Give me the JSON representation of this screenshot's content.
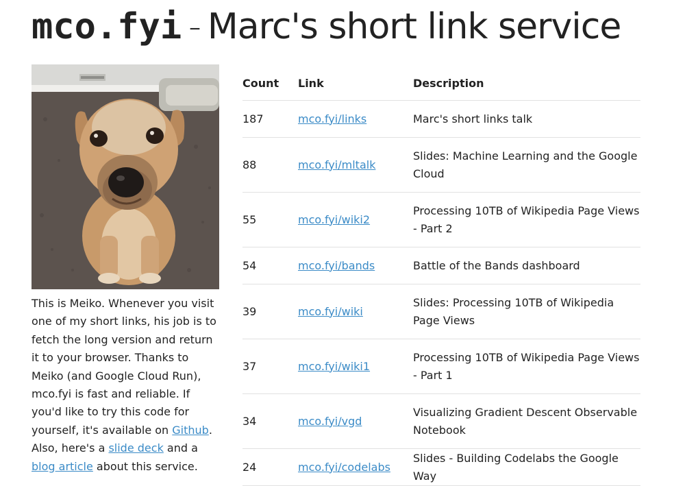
{
  "header": {
    "brand": "mco.fyi",
    "separator": "-",
    "subtitle": "Marc's short link service"
  },
  "sidebar": {
    "bio_part1": "This is Meiko. Whenever you visit one of my short links, his job is to fetch the long version and return it to your browser. Thanks to Meiko (and Google Cloud Run), mco.fyi is fast and reliable. If you'd like to try this code for yourself, it's available on ",
    "github_link": "Github",
    "bio_part2": ". Also, here's a ",
    "slides_link": "slide deck",
    "bio_part3": " and a ",
    "blog_link": "blog article",
    "bio_part4": " about this service."
  },
  "table": {
    "headers": {
      "count": "Count",
      "link": "Link",
      "description": "Description"
    },
    "rows": [
      {
        "count": "187",
        "link": "mco.fyi/links",
        "description": "Marc's short links talk"
      },
      {
        "count": "88",
        "link": "mco.fyi/mltalk",
        "description": "Slides: Machine Learning and the Google Cloud"
      },
      {
        "count": "55",
        "link": "mco.fyi/wiki2",
        "description": "Processing 10TB of Wikipedia Page Views - Part 2"
      },
      {
        "count": "54",
        "link": "mco.fyi/bands",
        "description": "Battle of the Bands dashboard"
      },
      {
        "count": "39",
        "link": "mco.fyi/wiki",
        "description": "Slides: Processing 10TB of Wikipedia Page Views"
      },
      {
        "count": "37",
        "link": "mco.fyi/wiki1",
        "description": "Processing 10TB of Wikipedia Page Views - Part 1"
      },
      {
        "count": "34",
        "link": "mco.fyi/vgd",
        "description": "Visualizing Gradient Descent Observable Notebook"
      },
      {
        "count": "24",
        "link": "mco.fyi/codelabs",
        "description": "Slides - Building Codelabs the Google Way"
      }
    ]
  },
  "colors": {
    "link": "#3b8bc7",
    "rule": "#e1e1e1",
    "text": "#222222"
  }
}
